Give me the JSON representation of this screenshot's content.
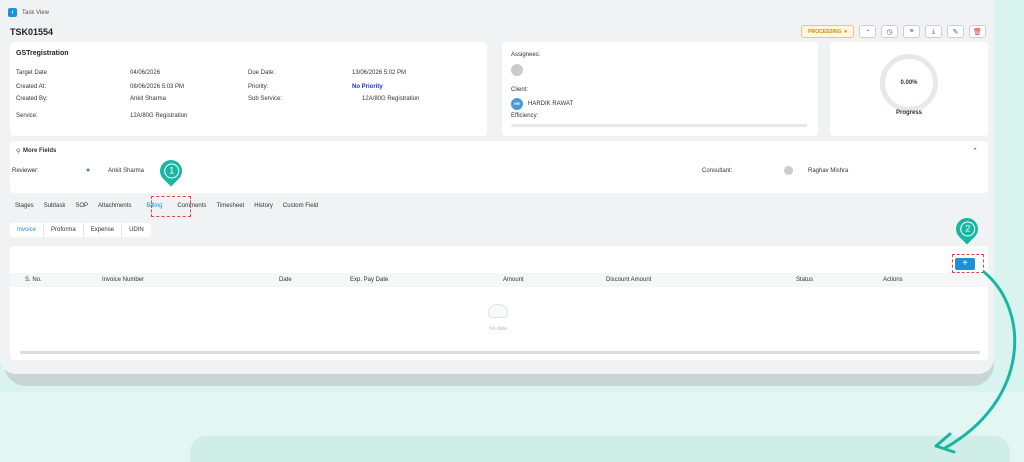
{
  "nav": {
    "back_label": "Task View"
  },
  "task": {
    "id": "TSK01554"
  },
  "toolbar": {
    "status": "PROCESSING",
    "status_caret": "▾"
  },
  "details": {
    "title": "GSTregistration",
    "target_date_label": "Target Date",
    "target_date": "04/06/2026",
    "due_date_label": "Due Date:",
    "due_date": "13/06/2026 5:02 PM",
    "created_at_label": "Created At:",
    "created_at": "08/06/2026 5:03 PM",
    "priority_label": "Priority:",
    "priority": "No Priority",
    "created_by_label": "Created By:",
    "created_by": "Ankit Sharma",
    "sub_service_label": "Sub Service:",
    "sub_service": "12A/80G Registration",
    "service_label": "Service:",
    "service": "12A/80G Registration"
  },
  "people": {
    "assignees_label": "Assignees:",
    "client_label": "Client:",
    "client_initials": "HR",
    "client_name": "HARDIK RAWAT",
    "efficiency_label": "Efficiency:"
  },
  "progress": {
    "value": "0.00%",
    "label": "Progress"
  },
  "more_fields": {
    "title": "More Fields",
    "reviewer_label": "Reviewer:",
    "reviewer": "Ankit Sharma",
    "consultant_label": "Consultant:",
    "consultant": "Raghav Mishra"
  },
  "tabs": [
    "Stages",
    "Subtask",
    "SOP",
    "Attachments",
    "Billing",
    "Comments",
    "Timesheet",
    "History",
    "Custom Field"
  ],
  "subtabs": [
    "Invoice",
    "Proforma",
    "Expense",
    "UDIN"
  ],
  "table": {
    "columns": [
      "S. No.",
      "Invoice Number",
      "Date",
      "Exp. Pay Date",
      "Amount",
      "Discount Amount",
      "Status",
      "Actions"
    ],
    "empty_text": "No data"
  },
  "add_button": "+",
  "markers": [
    "1",
    "2"
  ],
  "colors": {
    "accent": "#1e8fd8",
    "marker": "#19b6a3",
    "highlight": "#e04545",
    "status": "#d88a00"
  }
}
